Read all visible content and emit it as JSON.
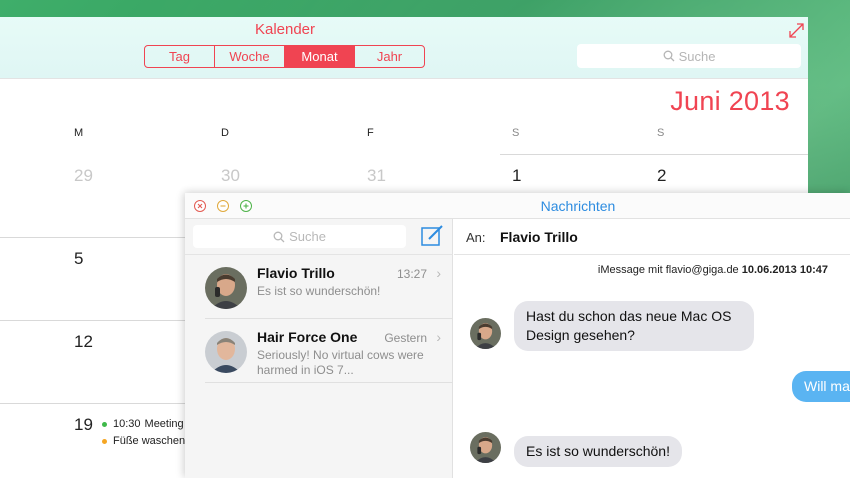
{
  "calendar": {
    "title": "Kalender",
    "segments": [
      {
        "label": "Tag",
        "active": false
      },
      {
        "label": "Woche",
        "active": false
      },
      {
        "label": "Monat",
        "active": true
      },
      {
        "label": "Jahr",
        "active": false
      }
    ],
    "search_placeholder": "Suche",
    "month_label": "Juni 2013",
    "day_headers": [
      "M",
      "D",
      "F",
      "S",
      "S"
    ],
    "row1": [
      "29",
      "30",
      "31",
      "1",
      "2"
    ],
    "row2_first": "5",
    "row3_first": "12",
    "row4_first": "19",
    "events": [
      {
        "time": "10:30",
        "title": "Meeting",
        "color": "#3fb94a"
      },
      {
        "time": "",
        "title": "Füße waschen",
        "color": "#f5a623"
      }
    ],
    "accent_color": "#f04452"
  },
  "messages": {
    "title": "Nachrichten",
    "search_placeholder": "Suche",
    "conversations": [
      {
        "name": "Flavio Trillo",
        "time": "13:27",
        "preview": "Es ist so wunderschön!"
      },
      {
        "name": "Hair Force One",
        "time": "Gestern",
        "preview": "Seriously! No virtual cows were harmed in iOS 7..."
      }
    ],
    "to_label": "An:",
    "to_name": "Flavio Trillo",
    "info_prefix": "iMessage mit flavio@giga.de",
    "info_datetime": "10.06.2013 10:47",
    "bubbles": [
      {
        "text": "Hast du schon das neue Mac OS Design gesehen?",
        "direction": "in"
      },
      {
        "text": "Will ma",
        "direction": "out"
      },
      {
        "text": "Es ist so wunderschön!",
        "direction": "in"
      }
    ],
    "accent_color": "#2d8ce0"
  }
}
